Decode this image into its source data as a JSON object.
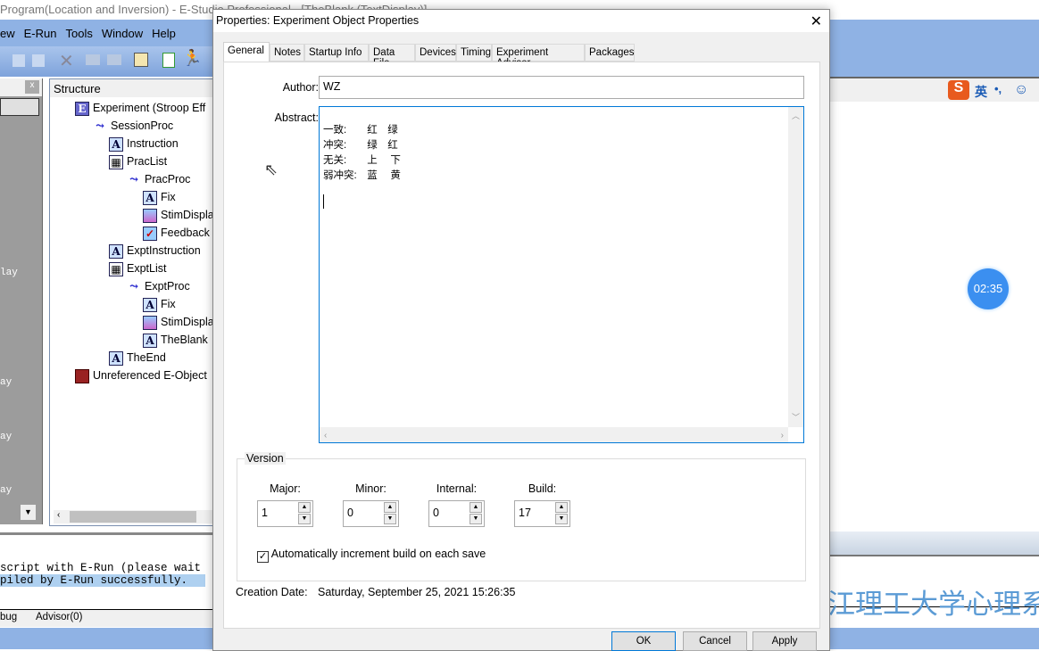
{
  "app": {
    "title": "Program(Location and Inversion) - E-Studio Professional - [TheBlank (TextDisplay)]",
    "menu": [
      "ew",
      "E-Run",
      "Tools",
      "Window",
      "Help"
    ],
    "structure_title": "Structure",
    "tree": [
      {
        "label": "Experiment (Stroop Eff",
        "icon": "experiment-icon",
        "level": 0
      },
      {
        "label": "SessionProc",
        "icon": "procedure-icon",
        "level": 1
      },
      {
        "label": "Instruction",
        "icon": "text-display-icon",
        "level": 2
      },
      {
        "label": "PracList",
        "icon": "list-icon",
        "level": 2
      },
      {
        "label": "PracProc",
        "icon": "procedure-icon",
        "level": 3
      },
      {
        "label": "Fix",
        "icon": "text-display-icon",
        "level": 4
      },
      {
        "label": "StimDispla",
        "icon": "image-display-icon",
        "level": 4
      },
      {
        "label": "Feedback",
        "icon": "feedback-icon",
        "level": 4
      },
      {
        "label": "ExptInstruction",
        "icon": "text-display-icon",
        "level": 2
      },
      {
        "label": "ExptList",
        "icon": "list-icon",
        "level": 2
      },
      {
        "label": "ExptProc",
        "icon": "procedure-icon",
        "level": 3
      },
      {
        "label": "Fix",
        "icon": "text-display-icon",
        "level": 4
      },
      {
        "label": "StimDispla",
        "icon": "image-display-icon",
        "level": 4
      },
      {
        "label": "TheBlank",
        "icon": "text-display-icon",
        "level": 4
      },
      {
        "label": "TheEnd",
        "icon": "text-display-icon",
        "level": 2
      },
      {
        "label": "Unreferenced E-Object",
        "icon": "unreferenced-icon",
        "level": 0
      }
    ],
    "left_fragments": [
      "lay",
      "ay",
      "ay",
      "ay"
    ],
    "output_lines": [
      "script with E-Run (please wait",
      "piled by E-Run successfully."
    ],
    "output_tabs": [
      "bug",
      "Advisor(0)"
    ],
    "ime": {
      "lang": "英",
      "punct": "•,"
    },
    "timer": "02:35",
    "watermark": "浙江理工大学心理系"
  },
  "dialog": {
    "title": "Properties: Experiment Object Properties",
    "close": "✕",
    "tabs": [
      "General",
      "Notes",
      "Startup Info",
      "Data File",
      "Devices",
      "Timing",
      "Experiment Advisor",
      "Packages"
    ],
    "active_tab": "General",
    "author_label": "Author:",
    "author": "WZ",
    "abstract_label": "Abstract:",
    "abstract_lines": [
      "一致:　　红　绿",
      "冲突:　　绿　红",
      "无关:　　上　 下",
      "弱冲突:　蓝　 黄"
    ],
    "version": {
      "legend": "Version",
      "fields": [
        {
          "label": "Major:",
          "value": "1"
        },
        {
          "label": "Minor:",
          "value": "0"
        },
        {
          "label": "Internal:",
          "value": "0"
        },
        {
          "label": "Build:",
          "value": "17"
        }
      ],
      "auto_increment_label": "Automatically increment build on each save",
      "auto_increment": true
    },
    "creation_label": "Creation Date:",
    "creation_date": "Saturday, September 25, 2021 15:26:35",
    "buttons": {
      "ok": "OK",
      "cancel": "Cancel",
      "apply": "Apply"
    }
  }
}
